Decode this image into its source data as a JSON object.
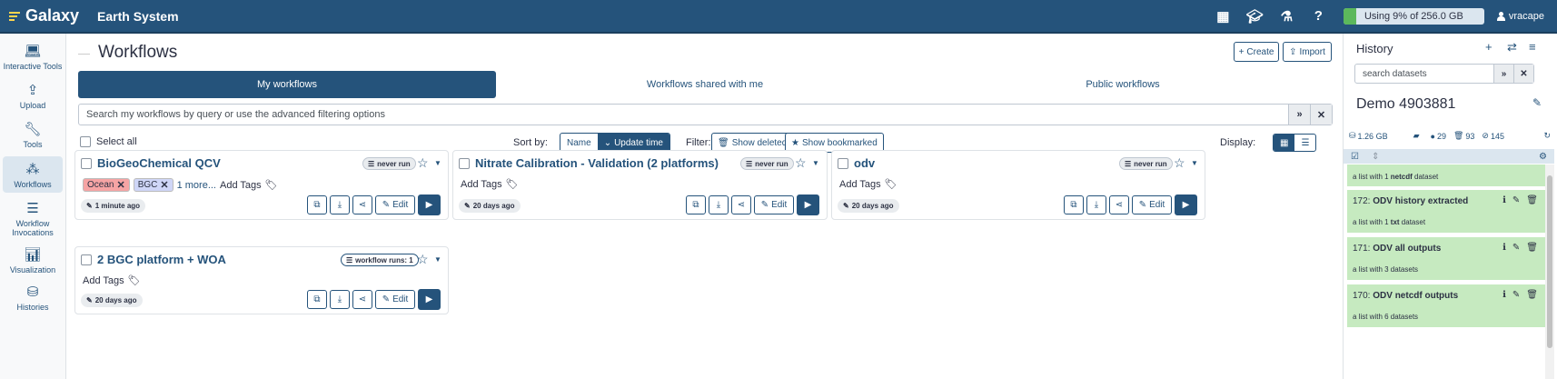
{
  "topbar": {
    "brand": "Galaxy",
    "title": "Earth System",
    "icons": [
      "grid-icon",
      "graduation-cap-icon",
      "flask-icon",
      "help-icon"
    ],
    "help": "?",
    "quota_label": "Using 9% of 256.0 GB",
    "quota_fraction": 0.09,
    "username": "vracape"
  },
  "activity_bar": {
    "items": [
      {
        "label": "Interactive Tools",
        "icon": "laptop-icon"
      },
      {
        "label": "Upload",
        "icon": "upload-icon"
      },
      {
        "label": "Tools",
        "icon": "wrench-icon"
      },
      {
        "label": "Workflows",
        "icon": "sitemap-icon",
        "active": true
      },
      {
        "label": "Workflow Invocations",
        "icon": "list-icon"
      },
      {
        "label": "Visualization",
        "icon": "chart-icon"
      },
      {
        "label": "Histories",
        "icon": "hdd-icon"
      }
    ]
  },
  "main": {
    "title": "Workflows",
    "create_label": "Create",
    "import_label": "Import",
    "tabs": [
      "My workflows",
      "Workflows shared with me",
      "Public workflows"
    ],
    "search_placeholder": "Search my workflows by query or use the advanced filtering options",
    "select_all": "Select all",
    "sort_by": "Sort by:",
    "sort_options": [
      "Name",
      "Update time"
    ],
    "filter_label": "Filter:",
    "show_deleted": "Show deleted",
    "show_bookmarked": "Show bookmarked",
    "display_label": "Display:",
    "cards": [
      {
        "name": "BioGeoChemical QCV",
        "badge": "never run",
        "tags": [
          "Ocean",
          "BGC"
        ],
        "more": "1 more...",
        "add_tags": "Add Tags",
        "date": "1 minute ago",
        "edit": "Edit"
      },
      {
        "name": "Nitrate Calibration - Validation (2 platforms)",
        "badge": "never run",
        "tags": [],
        "more": "",
        "add_tags": "Add Tags",
        "date": "20 days ago",
        "edit": "Edit"
      },
      {
        "name": "odv",
        "badge": "never run",
        "tags": [],
        "more": "",
        "add_tags": "Add Tags",
        "date": "20 days ago",
        "edit": "Edit"
      },
      {
        "name": "2 BGC platform + WOA",
        "badge": "workflow runs: 1",
        "tags": [],
        "more": "",
        "add_tags": "Add Tags",
        "date": "20 days ago",
        "edit": "Edit"
      }
    ]
  },
  "history": {
    "title": "History",
    "search_placeholder": "search datasets",
    "name": "Demo 4903881",
    "size": "1.26 GB",
    "counts": {
      "shown": "29",
      "deleted": "93",
      "hidden": "145"
    },
    "datasets": [
      {
        "title": "",
        "hid": "",
        "subtitle_pre": "a list with 1 ",
        "subtitle_bold": "netcdf",
        "subtitle_post": " dataset"
      },
      {
        "title": "ODV history extracted",
        "hid": "172:",
        "subtitle_pre": "a list with 1 ",
        "subtitle_bold": "txt",
        "subtitle_post": " dataset"
      },
      {
        "title": "ODV all outputs",
        "hid": "171:",
        "subtitle_pre": "a list with 3 datasets",
        "subtitle_bold": "",
        "subtitle_post": ""
      },
      {
        "title": "ODV netcdf outputs",
        "hid": "170:",
        "subtitle_pre": "a list with 6 datasets",
        "subtitle_bold": "",
        "subtitle_post": ""
      }
    ]
  }
}
